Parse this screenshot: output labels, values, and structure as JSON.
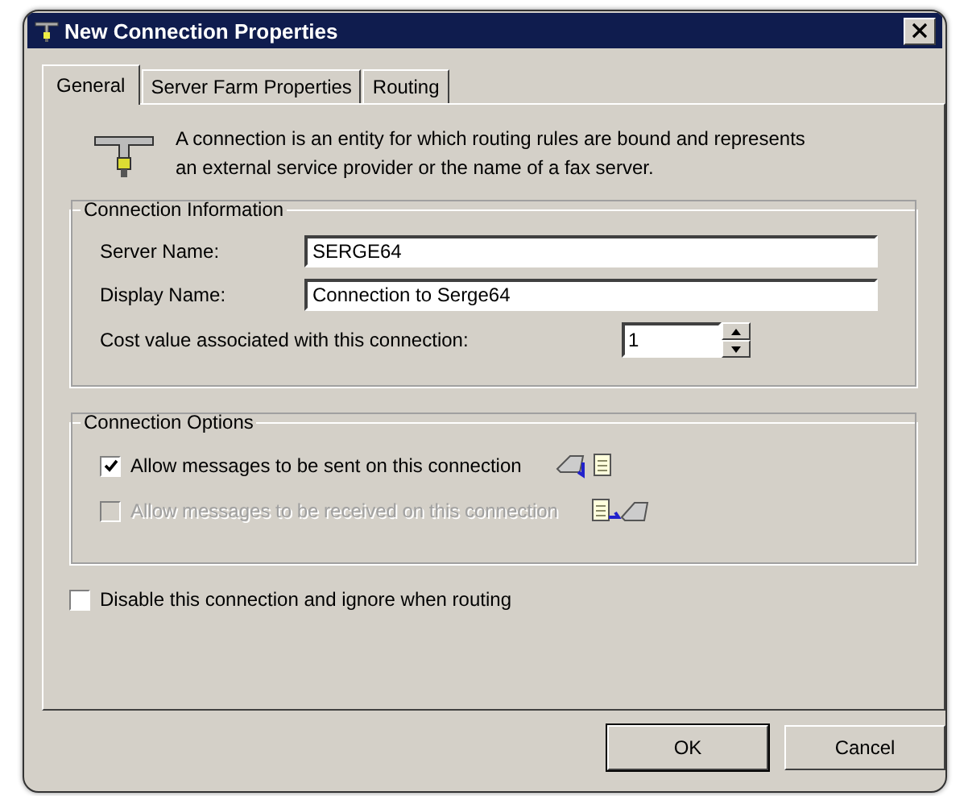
{
  "window": {
    "title": "New Connection Properties"
  },
  "tabs": [
    {
      "label": "General",
      "selected": true
    },
    {
      "label": "Server Farm Properties",
      "selected": false
    },
    {
      "label": "Routing",
      "selected": false
    }
  ],
  "description": "A connection is an entity for which routing rules are bound and represents an external service provider or the name of a fax server.",
  "connection_information": {
    "title": "Connection Information",
    "server_name": {
      "label": "Server Name:",
      "value": "SERGE64"
    },
    "display_name": {
      "label": "Display Name:",
      "value": "Connection to Serge64"
    },
    "cost": {
      "label": "Cost value associated with this connection:",
      "value": "1"
    }
  },
  "connection_options": {
    "title": "Connection Options",
    "options": [
      {
        "kind": "send",
        "label": "Allow messages to be sent on this connection",
        "checked": true,
        "disabled": false
      },
      {
        "kind": "receive",
        "label": "Allow messages to be received on this connection",
        "checked": false,
        "disabled": true
      }
    ]
  },
  "disable_option": {
    "label": "Disable this connection and ignore when routing",
    "checked": false
  },
  "buttons": [
    {
      "label": "OK",
      "default": true
    },
    {
      "label": "Cancel",
      "default": false
    }
  ]
}
